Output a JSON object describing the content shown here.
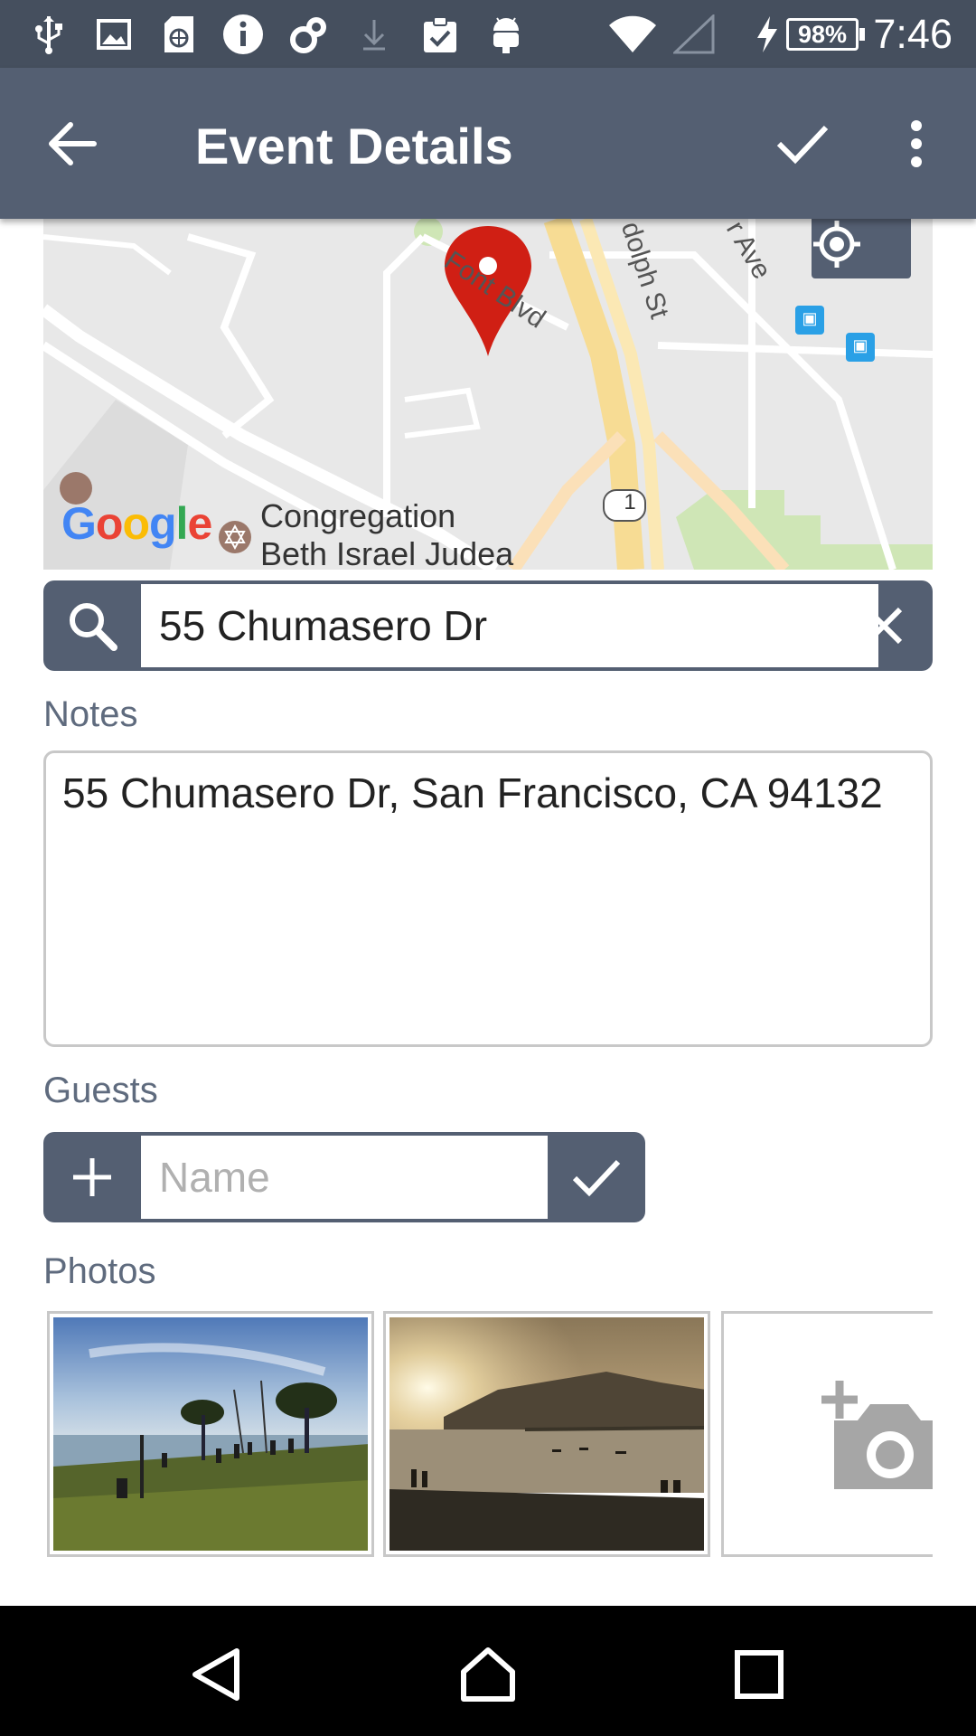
{
  "status_bar": {
    "time": "7:46",
    "battery_percent": "98%",
    "icons": [
      "usb-icon",
      "image-icon",
      "sd-card-icon",
      "info-icon",
      "sync-icon",
      "download-icon",
      "clipboard-check-icon",
      "android-icon",
      "wifi-icon",
      "cell-signal-icon",
      "charging-icon"
    ]
  },
  "app_bar": {
    "title": "Event Details",
    "back_icon": "arrow-left-icon",
    "save_icon": "check-icon",
    "menu_icon": "more-vert-icon"
  },
  "map": {
    "street_labels": [
      "Font Blvd",
      "dolph St",
      "r Ave"
    ],
    "route_shield": "1",
    "poi_name_line1": "Congregation",
    "poi_name_line2": "Beth Israel Judea",
    "attribution": "Google"
  },
  "search": {
    "value": "55 Chumasero Dr"
  },
  "notes": {
    "label": "Notes",
    "value": "55 Chumasero Dr, San Francisco, CA 94132"
  },
  "guests": {
    "label": "Guests",
    "placeholder": "Name"
  },
  "photos": {
    "label": "Photos"
  },
  "colors": {
    "app_bar": "#545f72",
    "status_bar": "#454f5e",
    "section_label": "#5f6b7e",
    "map_pin": "#d01f14"
  }
}
